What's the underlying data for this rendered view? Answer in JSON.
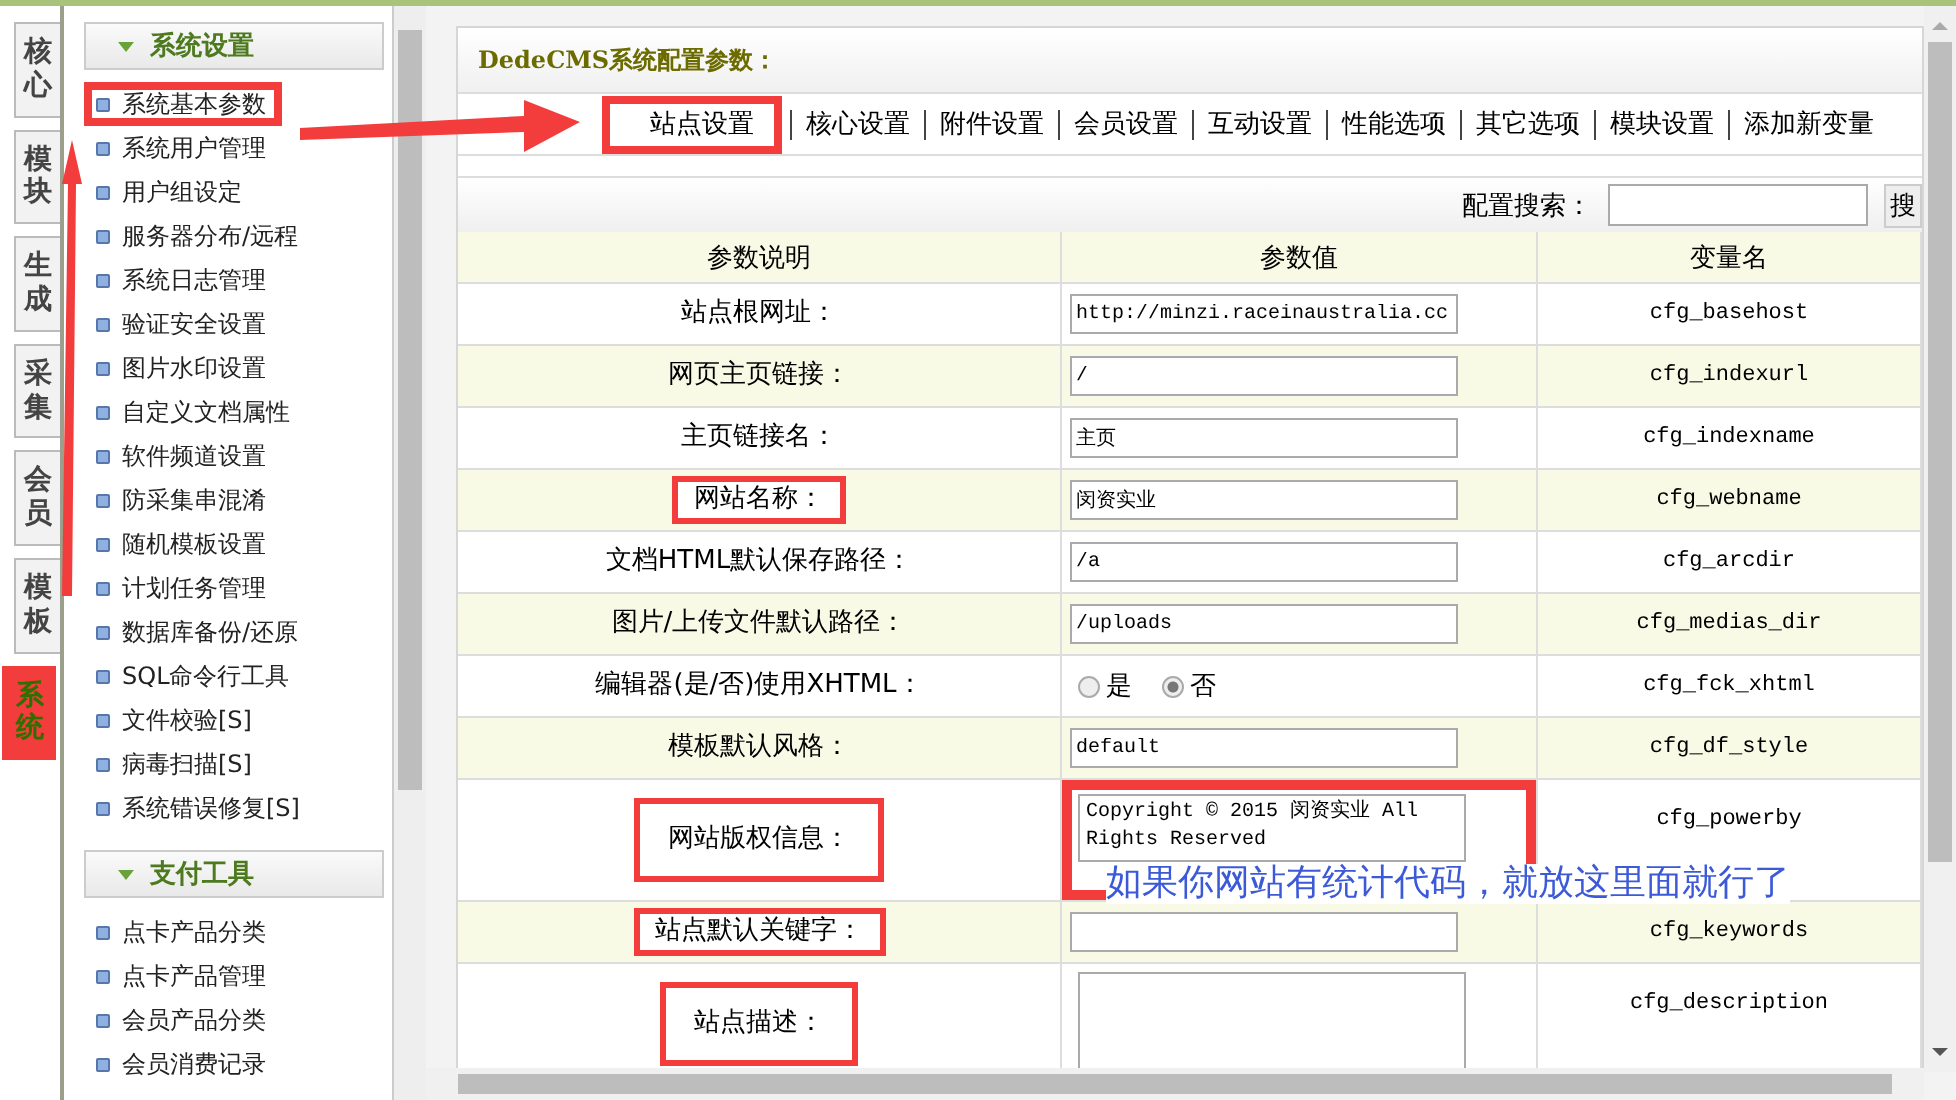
{
  "side_tabs": [
    {
      "label": "核心",
      "selected": false,
      "highlighted": false
    },
    {
      "label": "模块",
      "selected": false,
      "highlighted": false
    },
    {
      "label": "生成",
      "selected": false,
      "highlighted": false
    },
    {
      "label": "采集",
      "selected": false,
      "highlighted": false
    },
    {
      "label": "会员",
      "selected": false,
      "highlighted": false
    },
    {
      "label": "模板",
      "selected": false,
      "highlighted": false
    },
    {
      "label": "系统",
      "selected": true,
      "highlighted": true
    }
  ],
  "menu_groups": [
    {
      "title": "系统设置",
      "items": [
        {
          "label": "系统基本参数",
          "highlighted": true
        },
        {
          "label": "系统用户管理",
          "highlighted": false
        },
        {
          "label": "用户组设定",
          "highlighted": false
        },
        {
          "label": "服务器分布/远程",
          "highlighted": false
        },
        {
          "label": "系统日志管理",
          "highlighted": false
        },
        {
          "label": "验证安全设置",
          "highlighted": false
        },
        {
          "label": "图片水印设置",
          "highlighted": false
        },
        {
          "label": "自定义文档属性",
          "highlighted": false
        },
        {
          "label": "软件频道设置",
          "highlighted": false
        },
        {
          "label": "防采集串混淆",
          "highlighted": false
        },
        {
          "label": "随机模板设置",
          "highlighted": false
        },
        {
          "label": "计划任务管理",
          "highlighted": false
        },
        {
          "label": "数据库备份/还原",
          "highlighted": false
        },
        {
          "label": "SQL命令行工具",
          "highlighted": false
        },
        {
          "label": "文件校验[S]",
          "highlighted": false
        },
        {
          "label": "病毒扫描[S]",
          "highlighted": false
        },
        {
          "label": "系统错误修复[S]",
          "highlighted": false
        }
      ]
    },
    {
      "title": "支付工具",
      "items": [
        {
          "label": "点卡产品分类",
          "highlighted": false
        },
        {
          "label": "点卡产品管理",
          "highlighted": false
        },
        {
          "label": "会员产品分类",
          "highlighted": false
        },
        {
          "label": "会员消费记录",
          "highlighted": false
        }
      ]
    }
  ],
  "panel": {
    "title": "DedeCMS系统配置参数：",
    "tabs": [
      {
        "label": "站点设置",
        "selected": true,
        "highlighted": true
      },
      {
        "label": "核心设置",
        "selected": false,
        "highlighted": false
      },
      {
        "label": "附件设置",
        "selected": false,
        "highlighted": false
      },
      {
        "label": "会员设置",
        "selected": false,
        "highlighted": false
      },
      {
        "label": "互动设置",
        "selected": false,
        "highlighted": false
      },
      {
        "label": "性能选项",
        "selected": false,
        "highlighted": false
      },
      {
        "label": "其它选项",
        "selected": false,
        "highlighted": false
      },
      {
        "label": "模块设置",
        "selected": false,
        "highlighted": false
      },
      {
        "label": "添加新变量",
        "selected": false,
        "highlighted": false
      }
    ],
    "search": {
      "label": "配置搜索：",
      "button": "搜"
    },
    "columns": [
      "参数说明",
      "参数值",
      "变量名"
    ],
    "rows": [
      {
        "label": "站点根网址：",
        "kind": "text",
        "value": "http://minzi.raceinaustralia.cc",
        "var": "cfg_basehost",
        "label_highlighted": false,
        "value_highlighted": false
      },
      {
        "label": "网页主页链接：",
        "kind": "text",
        "value": "/",
        "var": "cfg_indexurl",
        "label_highlighted": false,
        "value_highlighted": false
      },
      {
        "label": "主页链接名：",
        "kind": "text",
        "value": "主页",
        "var": "cfg_indexname",
        "label_highlighted": false,
        "value_highlighted": false
      },
      {
        "label": "网站名称：",
        "kind": "text",
        "value": "闵资实业",
        "var": "cfg_webname",
        "label_highlighted": true,
        "value_highlighted": false
      },
      {
        "label": "文档HTML默认保存路径：",
        "kind": "text",
        "value": "/a",
        "var": "cfg_arcdir",
        "label_highlighted": false,
        "value_highlighted": false
      },
      {
        "label": "图片/上传文件默认路径：",
        "kind": "text",
        "value": "/uploads",
        "var": "cfg_medias_dir",
        "label_highlighted": false,
        "value_highlighted": false
      },
      {
        "label": "编辑器(是/否)使用XHTML：",
        "kind": "radio",
        "options": [
          {
            "label": "是",
            "selected": false
          },
          {
            "label": "否",
            "selected": true
          }
        ],
        "var": "cfg_fck_xhtml",
        "label_highlighted": false,
        "value_highlighted": false
      },
      {
        "label": "模板默认风格：",
        "kind": "text",
        "value": "default",
        "var": "cfg_df_style",
        "label_highlighted": false,
        "value_highlighted": false
      },
      {
        "label": "网站版权信息：",
        "kind": "textarea",
        "value": "Copyright © 2015 闵资实业 All Rights Reserved",
        "var": "cfg_powerby",
        "label_highlighted": true,
        "value_highlighted": true
      },
      {
        "label": "站点默认关键字：",
        "kind": "text",
        "var": "cfg_keywords",
        "label_highlighted": true,
        "value_highlighted": false
      },
      {
        "label": "站点描述：",
        "kind": "textarea",
        "var": "cfg_description",
        "label_highlighted": true,
        "value_highlighted": false
      }
    ]
  },
  "annotation_note": "如果你网站有统计代码，就放这里面就行了"
}
